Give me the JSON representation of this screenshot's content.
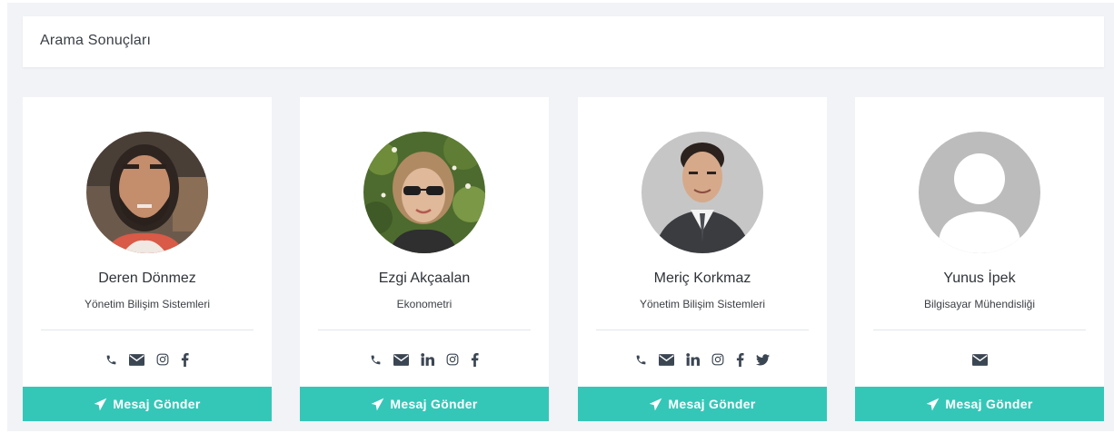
{
  "header": {
    "title": "Arama Sonuçları"
  },
  "colors": {
    "accent": "#34c7b8",
    "icon": "#3b4653",
    "panel_bg": "#f1f3f6"
  },
  "cards": [
    {
      "name": "Deren Dönmez",
      "department": "Yönetim Bilişim Sistemleri",
      "avatar": "photo-bearded-man",
      "contacts": [
        "phone-icon",
        "envelope-icon",
        "instagram-icon",
        "facebook-icon"
      ],
      "button_label": "Mesaj Gönder"
    },
    {
      "name": "Ezgi Akçaalan",
      "department": "Ekonometri",
      "avatar": "photo-woman-sunglasses",
      "contacts": [
        "phone-icon",
        "envelope-icon",
        "linkedin-icon",
        "instagram-icon",
        "facebook-icon"
      ],
      "button_label": "Mesaj Gönder"
    },
    {
      "name": "Meriç Korkmaz",
      "department": "Yönetim Bilişim Sistemleri",
      "avatar": "photo-man-suit",
      "contacts": [
        "phone-icon",
        "envelope-icon",
        "linkedin-icon",
        "instagram-icon",
        "facebook-icon",
        "twitter-icon"
      ],
      "button_label": "Mesaj Gönder"
    },
    {
      "name": "Yunus İpek",
      "department": "Bilgisayar Mühendisliği",
      "avatar": "default-avatar",
      "contacts": [
        "envelope-icon"
      ],
      "button_label": "Mesaj Gönder"
    }
  ]
}
